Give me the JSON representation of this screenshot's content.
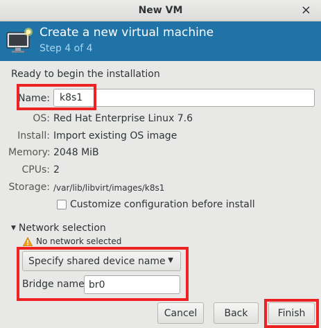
{
  "window": {
    "title": "New VM",
    "close_glyph": "×"
  },
  "banner": {
    "heading": "Create a new virtual machine",
    "step": "Step 4 of 4",
    "icon": "monitor-star-icon"
  },
  "ready_text": "Ready to begin the installation",
  "fields": {
    "name_label": "Name:",
    "name_value": "k8s1",
    "os_label": "OS:",
    "os_value": "Red Hat Enterprise Linux 7.6",
    "install_label": "Install:",
    "install_value": "Import existing OS image",
    "memory_label": "Memory:",
    "memory_value": "2048 MiB",
    "cpus_label": "CPUs:",
    "cpus_value": "2",
    "storage_label": "Storage:",
    "storage_value": "/var/lib/libvirt/images/k8s1"
  },
  "customize": {
    "label": "Customize configuration before install",
    "checked": false
  },
  "network": {
    "expander_label": "Network selection",
    "warning": "No network selected",
    "source_selected": "Specify shared device name",
    "bridge_label": "Bridge name:",
    "bridge_value": "br0"
  },
  "buttons": {
    "cancel": "Cancel",
    "back": "Back",
    "finish": "Finish"
  },
  "colors": {
    "banner": "#1f73a6",
    "highlight": "#ee2222",
    "window_bg": "#e8e8e7"
  }
}
